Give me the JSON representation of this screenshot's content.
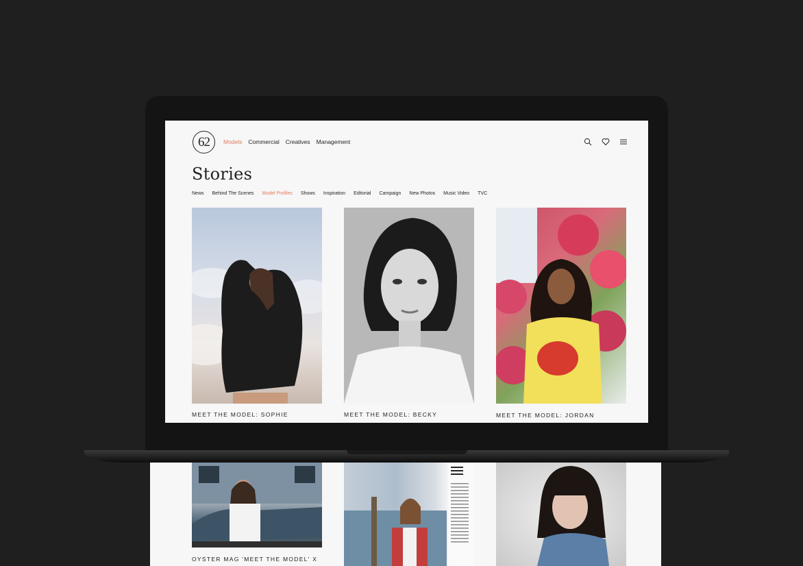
{
  "header": {
    "logo_text": "62",
    "nav": [
      "Models",
      "Commercial",
      "Creatives",
      "Management"
    ],
    "nav_active": "Models"
  },
  "page": {
    "title": "Stories",
    "categories": [
      "News",
      "Behind The Scenes",
      "Model Profiles",
      "Shows",
      "Inspiration",
      "Editorial",
      "Campaign",
      "New Photos",
      "Music Video",
      "TVC"
    ],
    "category_active": "Model Profiles"
  },
  "stories": [
    {
      "caption": "MEET THE MODEL: SOPHIE"
    },
    {
      "caption": "MEET THE MODEL: BECKY"
    },
    {
      "caption": "MEET THE MODEL: JORDAN"
    }
  ],
  "lower_stories": [
    {
      "caption": "OYSTER MAG 'MEET THE MODEL' X SOPHIA FRANKISH"
    }
  ],
  "icons": [
    "search-icon",
    "heart-icon",
    "menu-icon"
  ],
  "colors": {
    "accent": "#e07b5f",
    "background": "#1f1f1f",
    "page": "#f7f7f7"
  }
}
